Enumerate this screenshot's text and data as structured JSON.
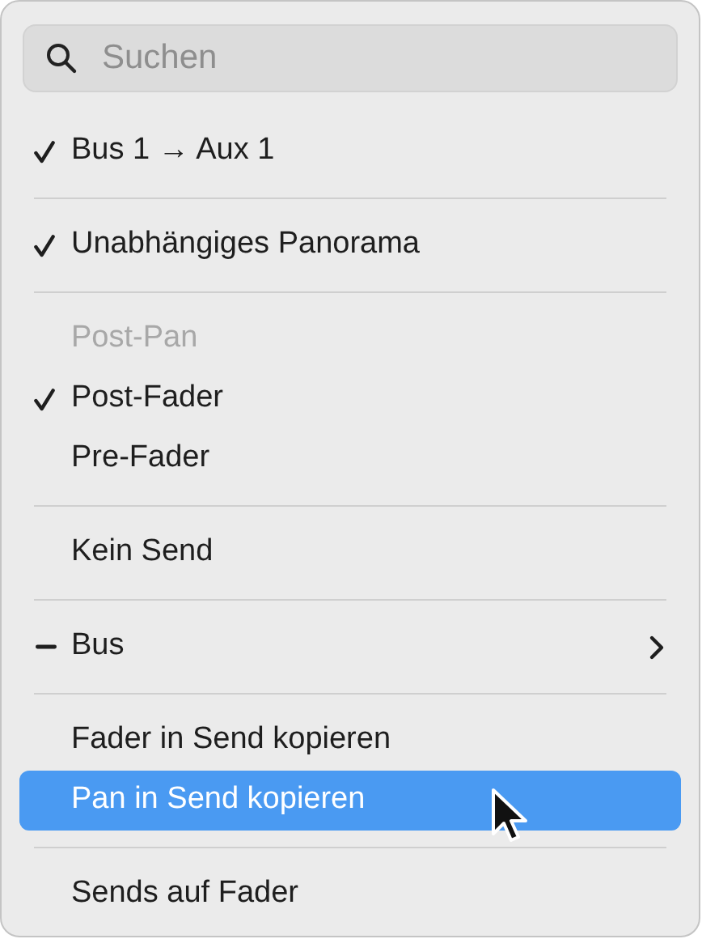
{
  "search": {
    "placeholder": "Suchen"
  },
  "sections": [
    {
      "items": [
        {
          "label": "Bus 1 → Aux 1",
          "checked": true,
          "mixed": false,
          "disabled": false,
          "selected": false,
          "submenu": false
        }
      ]
    },
    {
      "items": [
        {
          "label": "Unabhängiges Panorama",
          "checked": true,
          "mixed": false,
          "disabled": false,
          "selected": false,
          "submenu": false
        }
      ]
    },
    {
      "items": [
        {
          "label": "Post-Pan",
          "checked": false,
          "mixed": false,
          "disabled": true,
          "selected": false,
          "submenu": false
        },
        {
          "label": "Post-Fader",
          "checked": true,
          "mixed": false,
          "disabled": false,
          "selected": false,
          "submenu": false
        },
        {
          "label": "Pre-Fader",
          "checked": false,
          "mixed": false,
          "disabled": false,
          "selected": false,
          "submenu": false
        }
      ]
    },
    {
      "items": [
        {
          "label": "Kein Send",
          "checked": false,
          "mixed": false,
          "disabled": false,
          "selected": false,
          "submenu": false
        }
      ]
    },
    {
      "items": [
        {
          "label": "Bus",
          "checked": false,
          "mixed": true,
          "disabled": false,
          "selected": false,
          "submenu": true
        }
      ]
    },
    {
      "items": [
        {
          "label": "Fader in Send kopieren",
          "checked": false,
          "mixed": false,
          "disabled": false,
          "selected": false,
          "submenu": false
        },
        {
          "label": "Pan in Send kopieren",
          "checked": false,
          "mixed": false,
          "disabled": false,
          "selected": true,
          "submenu": false
        }
      ]
    },
    {
      "items": [
        {
          "label": "Sends auf Fader",
          "checked": false,
          "mixed": false,
          "disabled": false,
          "selected": false,
          "submenu": false
        }
      ]
    }
  ]
}
